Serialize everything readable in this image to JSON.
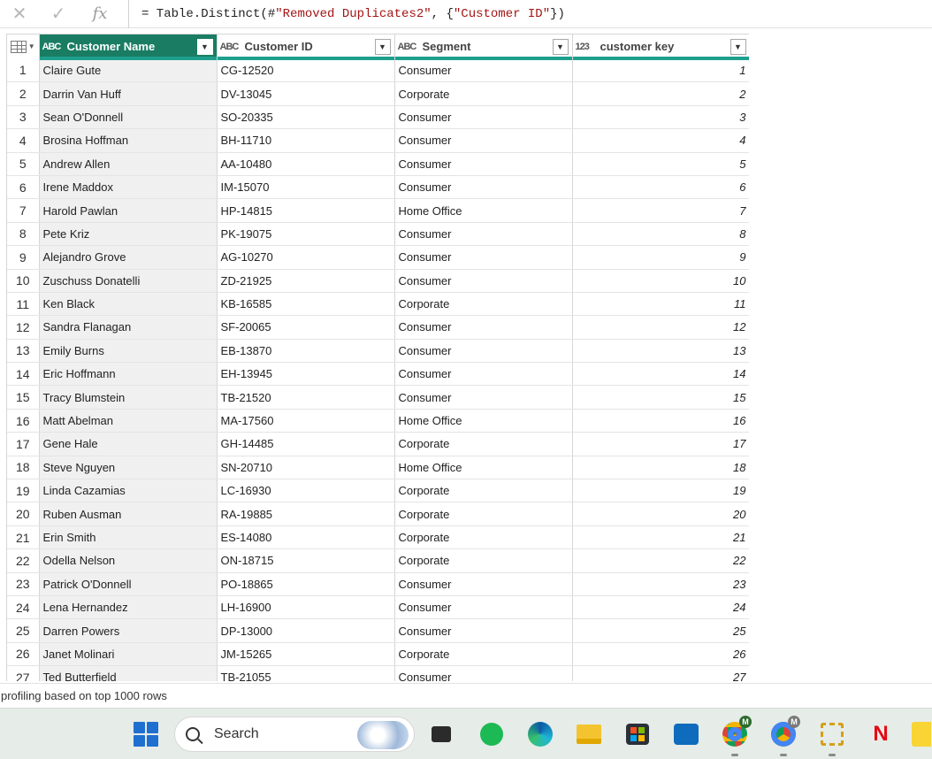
{
  "formula_bar": {
    "cancel_icon": "close-icon",
    "confirm_icon": "check-icon",
    "fx_label": "fx",
    "formula_prefix": "= Table.Distinct(#",
    "formula_str1": "\"Removed Duplicates2\"",
    "formula_mid": ", {",
    "formula_str2": "\"Customer ID\"",
    "formula_suffix": "})"
  },
  "columns": [
    {
      "type_icon": "ABC",
      "label": "Customer Name",
      "selected": true
    },
    {
      "type_icon": "ABC",
      "label": "Customer ID",
      "selected": false
    },
    {
      "type_icon": "ABC",
      "label": "Segment",
      "selected": false
    },
    {
      "type_icon": "123",
      "label": "customer key",
      "selected": false
    }
  ],
  "rows": [
    [
      "1",
      "Claire Gute",
      "CG-12520",
      "Consumer",
      "1"
    ],
    [
      "2",
      "Darrin Van Huff",
      "DV-13045",
      "Corporate",
      "2"
    ],
    [
      "3",
      "Sean O'Donnell",
      "SO-20335",
      "Consumer",
      "3"
    ],
    [
      "4",
      "Brosina Hoffman",
      "BH-11710",
      "Consumer",
      "4"
    ],
    [
      "5",
      "Andrew Allen",
      "AA-10480",
      "Consumer",
      "5"
    ],
    [
      "6",
      "Irene Maddox",
      "IM-15070",
      "Consumer",
      "6"
    ],
    [
      "7",
      "Harold Pawlan",
      "HP-14815",
      "Home Office",
      "7"
    ],
    [
      "8",
      "Pete Kriz",
      "PK-19075",
      "Consumer",
      "8"
    ],
    [
      "9",
      "Alejandro Grove",
      "AG-10270",
      "Consumer",
      "9"
    ],
    [
      "10",
      "Zuschuss Donatelli",
      "ZD-21925",
      "Consumer",
      "10"
    ],
    [
      "11",
      "Ken Black",
      "KB-16585",
      "Corporate",
      "11"
    ],
    [
      "12",
      "Sandra Flanagan",
      "SF-20065",
      "Consumer",
      "12"
    ],
    [
      "13",
      "Emily Burns",
      "EB-13870",
      "Consumer",
      "13"
    ],
    [
      "14",
      "Eric Hoffmann",
      "EH-13945",
      "Consumer",
      "14"
    ],
    [
      "15",
      "Tracy Blumstein",
      "TB-21520",
      "Consumer",
      "15"
    ],
    [
      "16",
      "Matt Abelman",
      "MA-17560",
      "Home Office",
      "16"
    ],
    [
      "17",
      "Gene Hale",
      "GH-14485",
      "Corporate",
      "17"
    ],
    [
      "18",
      "Steve Nguyen",
      "SN-20710",
      "Home Office",
      "18"
    ],
    [
      "19",
      "Linda Cazamias",
      "LC-16930",
      "Corporate",
      "19"
    ],
    [
      "20",
      "Ruben Ausman",
      "RA-19885",
      "Corporate",
      "20"
    ],
    [
      "21",
      "Erin Smith",
      "ES-14080",
      "Corporate",
      "21"
    ],
    [
      "22",
      "Odella Nelson",
      "ON-18715",
      "Corporate",
      "22"
    ],
    [
      "23",
      "Patrick O'Donnell",
      "PO-18865",
      "Consumer",
      "23"
    ],
    [
      "24",
      "Lena Hernandez",
      "LH-16900",
      "Consumer",
      "24"
    ],
    [
      "25",
      "Darren Powers",
      "DP-13000",
      "Consumer",
      "25"
    ],
    [
      "26",
      "Janet Molinari",
      "JM-15265",
      "Corporate",
      "26"
    ],
    [
      "27",
      "Ted Butterfield",
      "TB-21055",
      "Consumer",
      "27"
    ]
  ],
  "status_text": "profiling based on top 1000 rows",
  "taskbar": {
    "search_label": "Search",
    "badge_m1": "M",
    "badge_m2": "M",
    "netflix_label": "N",
    "items": [
      "windows-start-icon",
      "search-icon",
      "terminal-icon",
      "spotify-icon",
      "edge-icon",
      "file-explorer-icon",
      "store-icon",
      "outlook-icon",
      "chrome-icon",
      "chrome-icon",
      "snipping-tool-icon",
      "netflix-icon",
      "sticky-notes-icon"
    ]
  },
  "colors": {
    "selected_header": "#1a7d63",
    "quality_bar": "#1e9f8e",
    "taskbar": "#e6ece8"
  }
}
